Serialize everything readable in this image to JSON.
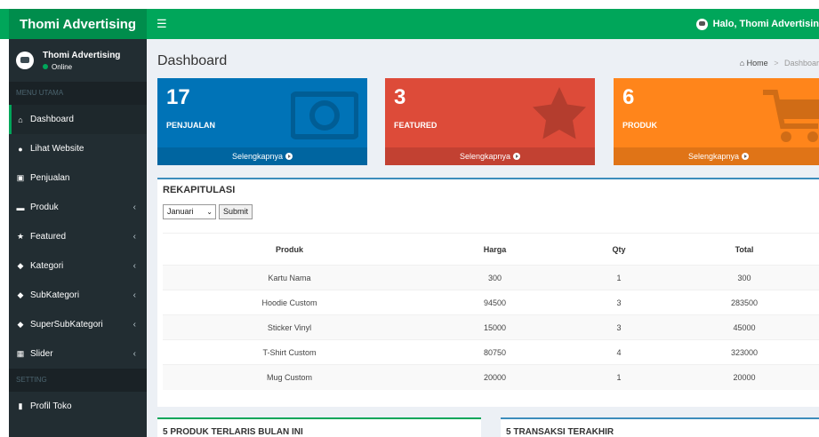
{
  "app": {
    "title": "Thomi Advertising"
  },
  "topbar": {
    "user_greeting": "Halo, Thomi Advertisin"
  },
  "sidebar": {
    "user": {
      "name": "Thomi Advertising",
      "status": "Online"
    },
    "sections": [
      "MENU UTAMA",
      "SETTING"
    ],
    "items": [
      {
        "label": "Dashboard",
        "icon": "home-icon"
      },
      {
        "label": "Lihat Website",
        "icon": "globe-icon"
      },
      {
        "label": "Penjualan",
        "icon": "money-icon"
      },
      {
        "label": "Produk",
        "icon": "cart-icon"
      },
      {
        "label": "Featured",
        "icon": "star-icon"
      },
      {
        "label": "Kategori",
        "icon": "tag-icon"
      },
      {
        "label": "SubKategori",
        "icon": "tag-icon"
      },
      {
        "label": "SuperSubKategori",
        "icon": "tag-icon"
      },
      {
        "label": "Slider",
        "icon": "image-icon"
      },
      {
        "label": "Profil Toko",
        "icon": "building-icon"
      }
    ]
  },
  "header": {
    "title": "Dashboard",
    "breadcrumb": [
      "Home",
      "Dashboar"
    ]
  },
  "stats": [
    {
      "value": "17",
      "label": "PENJUALAN",
      "link": "Selengkapnya",
      "color": "#0073b7"
    },
    {
      "value": "3",
      "label": "FEATURED",
      "link": "Selengkapnya",
      "color": "#dd4b39"
    },
    {
      "value": "6",
      "label": "PRODUK",
      "link": "Selengkapnya",
      "color": "#ff851b"
    }
  ],
  "rekap": {
    "title": "REKAPITULASI",
    "month": "Januari",
    "submit": "Submit",
    "columns": [
      "Produk",
      "Harga",
      "Qty",
      "Total"
    ],
    "rows": [
      [
        "Kartu Nama",
        "300",
        "1",
        "300"
      ],
      [
        "Hoodie Custom",
        "94500",
        "3",
        "283500"
      ],
      [
        "Sticker Vinyl",
        "15000",
        "3",
        "45000"
      ],
      [
        "T-Shirt Custom",
        "80750",
        "4",
        "323000"
      ],
      [
        "Mug Custom",
        "20000",
        "1",
        "20000"
      ]
    ]
  },
  "bottom": {
    "left_title": "5 PRODUK TERLARIS BULAN INI",
    "right_title": "5 TRANSAKSI TERAKHIR"
  }
}
